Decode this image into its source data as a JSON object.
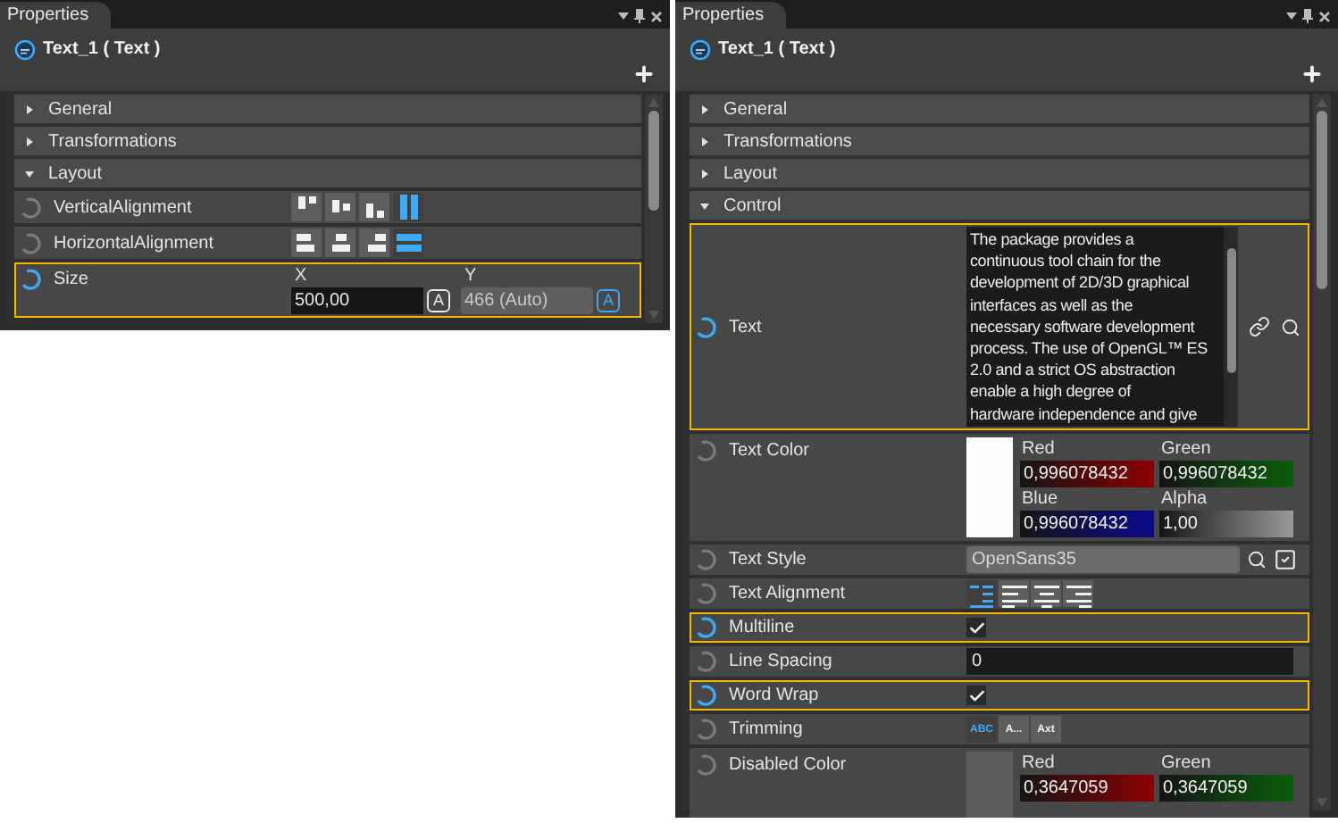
{
  "panels": [
    {
      "tab": "Properties",
      "title": "Text_1 ( Text )",
      "sections": [
        {
          "label": "General",
          "expanded": false
        },
        {
          "label": "Transformations",
          "expanded": false
        },
        {
          "label": "Layout",
          "expanded": true,
          "rows": [
            {
              "kind": "valign",
              "label": "VerticalAlignment",
              "modified": false,
              "highlighted": false,
              "options": [
                {
                  "selected": false
                },
                {
                  "selected": false
                },
                {
                  "selected": false
                },
                {
                  "selected": true
                }
              ]
            },
            {
              "kind": "halign",
              "label": "HorizontalAlignment",
              "modified": false,
              "highlighted": false,
              "options": [
                {
                  "selected": false
                },
                {
                  "selected": false
                },
                {
                  "selected": false
                },
                {
                  "selected": true
                }
              ]
            },
            {
              "kind": "size",
              "label": "Size",
              "modified": true,
              "highlighted": true,
              "fields": [
                {
                  "label": "X",
                  "value": "500,00",
                  "auto": false,
                  "auto_button": "A"
                },
                {
                  "label": "Y",
                  "value": "466 (Auto)",
                  "auto": true,
                  "auto_button": "A"
                }
              ]
            }
          ]
        }
      ]
    },
    {
      "tab": "Properties",
      "title": "Text_1 ( Text )",
      "sections": [
        {
          "label": "General",
          "expanded": false
        },
        {
          "label": "Transformations",
          "expanded": false
        },
        {
          "label": "Layout",
          "expanded": false
        },
        {
          "label": "Control",
          "expanded": true,
          "rows": [
            {
              "kind": "textarea",
              "label": "Text",
              "modified": true,
              "highlighted": true,
              "lines": [
                "The package provides a",
                "continuous tool chain for the",
                "development of 2D/3D graphical",
                "interfaces as well as the",
                "necessary software development",
                "process. The use of OpenGL™ ES",
                "2.0 and a strict OS abstraction",
                "enable a high degree of",
                "hardware independence and give"
              ]
            },
            {
              "kind": "color",
              "label": "Text Color",
              "modified": false,
              "highlighted": false,
              "color": "#fefefe",
              "channels": [
                {
                  "label": "Red",
                  "value": "0,996078432"
                },
                {
                  "label": "Green",
                  "value": "0,996078432"
                },
                {
                  "label": "Blue",
                  "value": "0,996078432"
                },
                {
                  "label": "Alpha",
                  "value": "1,00"
                }
              ]
            },
            {
              "kind": "style",
              "label": "Text Style",
              "modified": false,
              "highlighted": false,
              "value": "OpenSans35"
            },
            {
              "kind": "textalign",
              "label": "Text Alignment",
              "modified": false,
              "highlighted": false,
              "options": [
                {
                  "selected": true
                },
                {
                  "selected": false
                },
                {
                  "selected": false
                },
                {
                  "selected": false
                }
              ]
            },
            {
              "kind": "checkbox",
              "label": "Multiline",
              "modified": true,
              "highlighted": true,
              "checked": true
            },
            {
              "kind": "field",
              "label": "Line Spacing",
              "modified": false,
              "highlighted": false,
              "value": "0"
            },
            {
              "kind": "checkbox",
              "label": "Word Wrap",
              "modified": true,
              "highlighted": true,
              "checked": true
            },
            {
              "kind": "trimming",
              "label": "Trimming",
              "modified": false,
              "highlighted": false,
              "options": [
                {
                  "text": "ABC",
                  "selected": true
                },
                {
                  "text": "A...",
                  "selected": false
                },
                {
                  "text": "Axt",
                  "selected": false
                }
              ]
            },
            {
              "kind": "color",
              "label": "Disabled Color",
              "modified": false,
              "highlighted": false,
              "color": "#5d5d5d",
              "channels": [
                {
                  "label": "Red",
                  "value": "0,3647059"
                },
                {
                  "label": "Green",
                  "value": "0,3647059"
                }
              ]
            }
          ]
        }
      ]
    }
  ]
}
